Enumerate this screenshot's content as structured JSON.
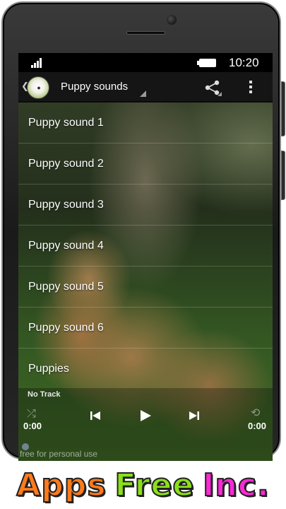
{
  "status_bar": {
    "time": "10:20"
  },
  "action_bar": {
    "title": "Puppy sounds",
    "share_icon": "share-icon",
    "overflow_icon": "overflow-menu-icon"
  },
  "list": {
    "items": [
      "Puppy sound 1",
      "Puppy sound 2",
      "Puppy sound 3",
      "Puppy sound 4",
      "Puppy sound 5",
      "Puppy sound 6",
      "Puppies"
    ]
  },
  "player": {
    "track": "No Track",
    "current_time": "0:00",
    "duration": "0:00",
    "footer": "free for personal use"
  },
  "banner": {
    "words": [
      "Apps",
      "Free",
      "Inc."
    ],
    "colors": [
      "#ff7a1a",
      "#8be01a",
      "#ff28d8"
    ]
  }
}
